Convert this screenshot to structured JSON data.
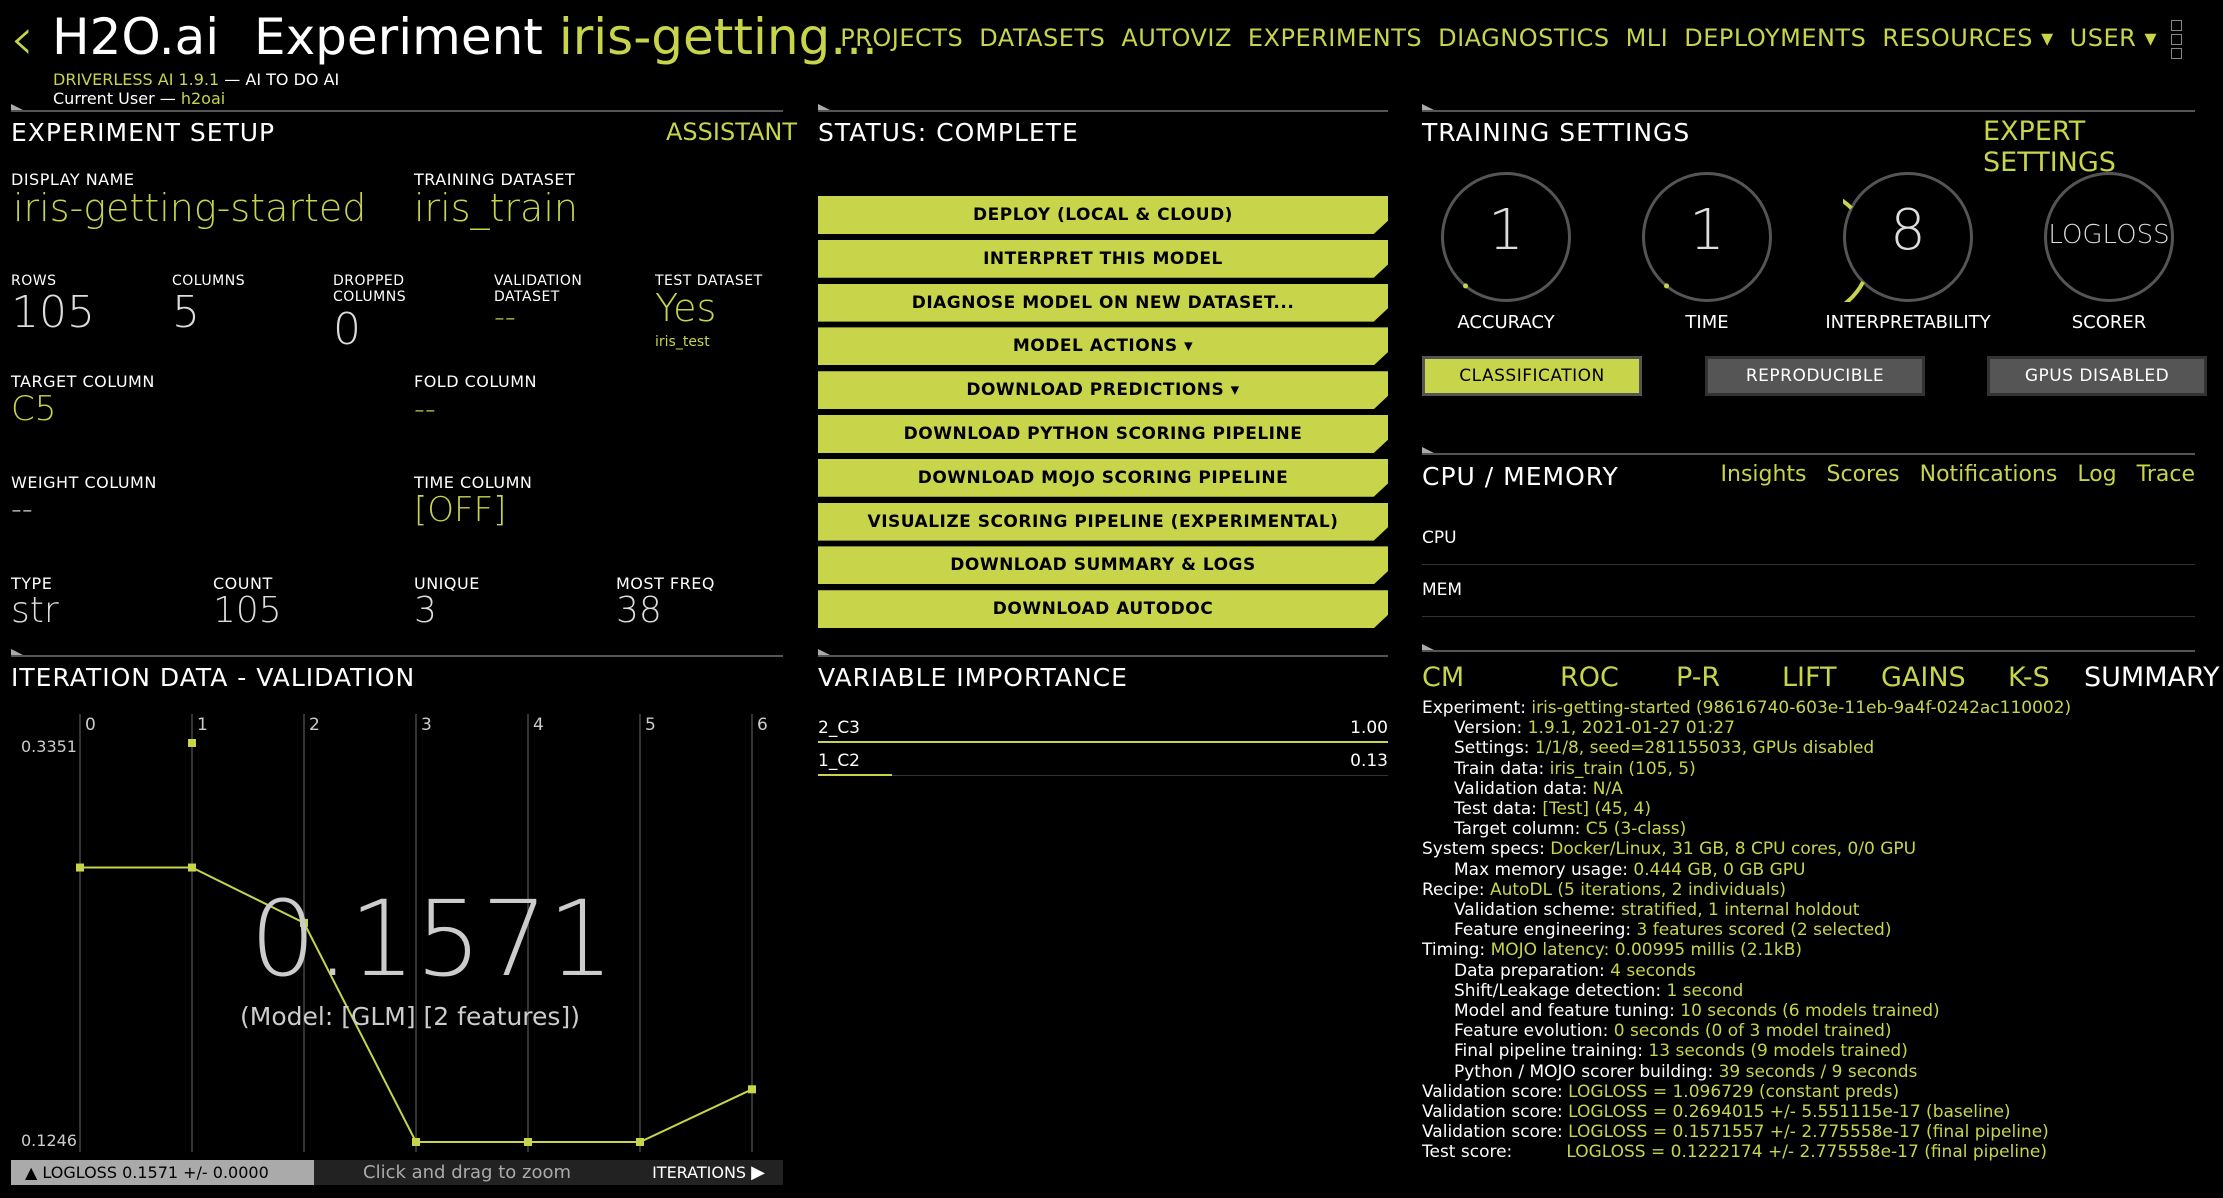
{
  "header": {
    "back": "‹",
    "brand": "H2O.ai",
    "experiment_word": "Experiment",
    "experiment_name": "iris-getting...",
    "product": "DRIVERLESS AI 1.9.1",
    "tagline": " — AI TO DO AI",
    "current_user_label": "Current User — ",
    "current_user": "h2oai",
    "nav": [
      "PROJECTS",
      "DATASETS",
      "AUTOVIZ",
      "EXPERIMENTS",
      "DIAGNOSTICS",
      "MLI",
      "DEPLOYMENTS",
      "RESOURCES ▾",
      "USER ▾"
    ]
  },
  "setup": {
    "title": "EXPERIMENT SETUP",
    "assistant": "ASSISTANT",
    "display_name_label": "DISPLAY NAME",
    "display_name": "iris-getting-started",
    "training_dataset_label": "TRAINING DATASET",
    "training_dataset": "iris_train",
    "rows_label": "ROWS",
    "rows": "105",
    "columns_label": "COLUMNS",
    "columns": "5",
    "dropped_label_1": "DROPPED",
    "dropped_label_2": "COLUMNS",
    "dropped": "0",
    "validation_label_1": "VALIDATION",
    "validation_label_2": "DATASET",
    "validation": "--",
    "test_label": "TEST DATASET",
    "test": "Yes",
    "test_name": "iris_test",
    "target_label": "TARGET COLUMN",
    "target": "C5",
    "fold_label": "FOLD COLUMN",
    "fold": "--",
    "weight_label": "WEIGHT COLUMN",
    "weight": "--",
    "time_label": "TIME COLUMN",
    "time": "[OFF]",
    "type_label": "TYPE",
    "type": "str",
    "count_label": "COUNT",
    "count": "105",
    "unique_label": "UNIQUE",
    "unique": "3",
    "mostfreq_label": "MOST FREQ",
    "mostfreq": "38"
  },
  "status": {
    "title": "STATUS: COMPLETE",
    "buttons": [
      "DEPLOY (LOCAL & CLOUD)",
      "INTERPRET THIS MODEL",
      "DIAGNOSE MODEL ON NEW DATASET...",
      "MODEL ACTIONS ▾",
      "DOWNLOAD PREDICTIONS ▾",
      "DOWNLOAD PYTHON SCORING PIPELINE",
      "DOWNLOAD MOJO SCORING PIPELINE",
      "VISUALIZE SCORING PIPELINE (EXPERIMENTAL)",
      "DOWNLOAD SUMMARY & LOGS",
      "DOWNLOAD AUTODOC"
    ]
  },
  "training": {
    "title": "TRAINING SETTINGS",
    "expert": "EXPERT SETTINGS",
    "dials": [
      {
        "value": "1",
        "label": "ACCURACY",
        "level": 0.1
      },
      {
        "value": "1",
        "label": "TIME",
        "level": 0.1
      },
      {
        "value": "8",
        "label": "INTERPRETABILITY",
        "level": 0.8
      },
      {
        "value": "LOGLOSS",
        "label": "SCORER",
        "level": 0
      }
    ],
    "toggles": [
      "CLASSIFICATION",
      "REPRODUCIBLE",
      "GPUS DISABLED"
    ]
  },
  "cpu": {
    "title": "CPU / MEMORY",
    "links": [
      "Insights",
      "Scores",
      "Notifications",
      "Log",
      "Trace"
    ],
    "cpu_label": "CPU",
    "mem_label": "MEM"
  },
  "iteration": {
    "title": "ITERATION DATA - VALIDATION",
    "big_value": "0.1571",
    "model_text": "(Model: [GLM] [2 features])",
    "ymax_label": "0.3351",
    "ymin_label": "0.1246",
    "footer_left": "LOGLOSS 0.1571 +/- 0.0000",
    "footer_mid": "Click and drag to zoom",
    "footer_right": "ITERATIONS"
  },
  "chart_data": {
    "type": "line",
    "x": [
      0,
      1,
      2,
      3,
      4,
      5,
      6
    ],
    "values": [
      0.2694,
      0.2694,
      0.2402,
      0.1246,
      0.1246,
      0.1246,
      0.1524
    ],
    "extra_point": {
      "x": 1,
      "y": 0.3351
    },
    "xlabel": "ITERATIONS",
    "ylabel": "LOGLOSS",
    "ylim": [
      0.1246,
      0.3351
    ]
  },
  "varimp": {
    "title": "VARIABLE IMPORTANCE",
    "items": [
      {
        "name": "2_C3",
        "value": "1.00",
        "frac": 1.0
      },
      {
        "name": "1_C2",
        "value": "0.13",
        "frac": 0.13
      }
    ]
  },
  "tabs": [
    "CM",
    "ROC",
    "P-R",
    "LIFT",
    "GAINS",
    "K-S",
    "SUMMARY"
  ],
  "summary": [
    {
      "indent": 0,
      "k": "Experiment: ",
      "v": "iris-getting-started (98616740-603e-11eb-9a4f-0242ac110002)"
    },
    {
      "indent": 1,
      "k": "Version: ",
      "v": "1.9.1, 2021-01-27 01:27"
    },
    {
      "indent": 1,
      "k": "Settings: ",
      "v": "1/1/8, seed=281155033, GPUs disabled"
    },
    {
      "indent": 1,
      "k": "Train data: ",
      "v": "iris_train (105, 5)"
    },
    {
      "indent": 1,
      "k": "Validation data: ",
      "v": "N/A"
    },
    {
      "indent": 1,
      "k": "Test data: ",
      "v": "[Test] (45, 4)"
    },
    {
      "indent": 1,
      "k": "Target column: ",
      "v": "C5 (3-class)"
    },
    {
      "indent": 0,
      "k": "System specs: ",
      "v": "Docker/Linux, 31 GB, 8 CPU cores, 0/0 GPU"
    },
    {
      "indent": 1,
      "k": "Max memory usage: ",
      "v": "0.444 GB, 0 GB GPU"
    },
    {
      "indent": 0,
      "k": "Recipe: ",
      "v": "AutoDL (5 iterations, 2 individuals)"
    },
    {
      "indent": 1,
      "k": "Validation scheme: ",
      "v": "stratified, 1 internal holdout"
    },
    {
      "indent": 1,
      "k": "Feature engineering: ",
      "v": "3 features scored (2 selected)"
    },
    {
      "indent": 0,
      "k": "Timing: ",
      "v": "MOJO latency: 0.00995 millis (2.1kB)"
    },
    {
      "indent": 1,
      "k": "Data preparation: ",
      "v": "4 seconds"
    },
    {
      "indent": 1,
      "k": "Shift/Leakage detection: ",
      "v": "1 second"
    },
    {
      "indent": 1,
      "k": "Model and feature tuning: ",
      "v": "10 seconds (6 models trained)"
    },
    {
      "indent": 1,
      "k": "Feature evolution: ",
      "v": "0 seconds (0 of 3 model trained)"
    },
    {
      "indent": 1,
      "k": "Final pipeline training: ",
      "v": "13 seconds (9 models trained)"
    },
    {
      "indent": 1,
      "k": "Python / MOJO scorer building: ",
      "v": "39 seconds / 9 seconds"
    },
    {
      "indent": 0,
      "k": "Validation score: ",
      "v": "LOGLOSS = 1.096729 (constant preds)"
    },
    {
      "indent": 0,
      "k": "Validation score: ",
      "v": "LOGLOSS = 0.2694015 +/- 5.551115e-17 (baseline)"
    },
    {
      "indent": 0,
      "k": "Validation score: ",
      "v": "LOGLOSS = 0.1571557 +/- 2.775558e-17 (final pipeline)"
    },
    {
      "indent": 0,
      "k": "Test score:          ",
      "v": "LOGLOSS = 0.1222174 +/- 2.775558e-17 (final pipeline)"
    }
  ]
}
